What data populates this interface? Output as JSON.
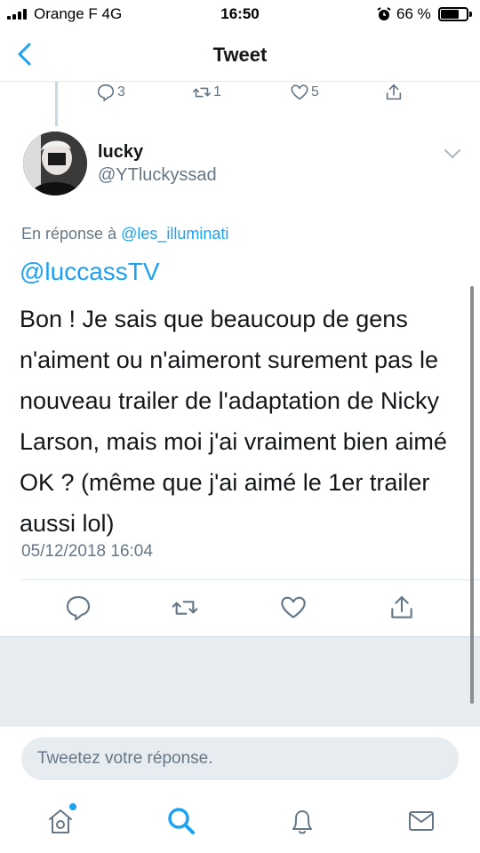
{
  "status_bar": {
    "carrier": "Orange F   4G",
    "time": "16:50",
    "battery_percent": "66 %",
    "battery_level": 0.66
  },
  "nav": {
    "title": "Tweet"
  },
  "previous_tweet_actions": {
    "reply_count": "3",
    "retweet_count": "1",
    "like_count": "5"
  },
  "tweet": {
    "author_name": "lucky",
    "author_handle": "@YTluckyssad",
    "in_reply_prefix": "En réponse à ",
    "in_reply_handle": "@les_illuminati",
    "mention": "@luccassTV",
    "text": "Bon ! Je sais que beaucoup de gens n'aiment ou n'aimeront surement pas le nouveau trailer de l'adaptation de Nicky Larson, mais moi j'ai vraiment bien aimé OK ?  (même que j'ai aimé le 1er trailer aussi lol)",
    "timestamp": "05/12/2018 16:04"
  },
  "compose": {
    "placeholder": "Tweetez votre réponse."
  },
  "tabs": [
    "home-icon",
    "search-icon",
    "notifications-icon",
    "messages-icon"
  ],
  "colors": {
    "accent": "#1da1f2",
    "muted": "#657786",
    "background_gray": "#e6ecf0"
  }
}
